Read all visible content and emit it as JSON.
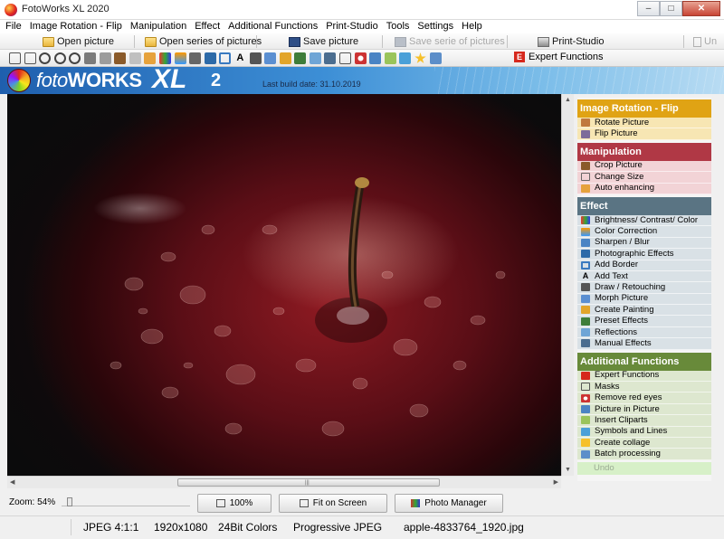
{
  "window": {
    "title": "FotoWorks XL 2020",
    "controls": [
      "–",
      "□",
      "✕"
    ]
  },
  "menu": [
    "File",
    "Image Rotation - Flip",
    "Manipulation",
    "Effect",
    "Additional Functions",
    "Print-Studio",
    "Tools",
    "Settings",
    "Help"
  ],
  "toolbar": {
    "open_picture": "Open picture",
    "open_series": "Open series of pictures",
    "save_picture": "Save picture",
    "save_series": "Save serie of pictures",
    "print_studio": "Print-Studio",
    "undo_truncated": "Un",
    "expert_functions": "Expert Functions",
    "expert_badge": "E"
  },
  "banner": {
    "logo_foto": "foto",
    "logo_works": "WORKS",
    "logo_xl": "XL",
    "logo_version": "2",
    "build_date": "Last build date: 31.10.2019"
  },
  "panel": {
    "rotation": {
      "title": "Image Rotation - Flip",
      "color": "#e0a314",
      "bg": "#f7e6b3",
      "items": [
        "Rotate Picture",
        "Flip Picture"
      ]
    },
    "manipulation": {
      "title": "Manipulation",
      "color": "#b03845",
      "bg": "#f2d3d6",
      "items": [
        "Crop Picture",
        "Change Size",
        "Auto enhancing"
      ]
    },
    "effect": {
      "title": "Effect",
      "color": "#5a7483",
      "bg": "#d9e1e6",
      "items": [
        "Brightness/ Contrast/ Color",
        "Color Correction",
        "Sharpen / Blur",
        "Photographic Effects",
        "Add Border",
        "Add Text",
        "Draw / Retouching",
        "Morph Picture",
        "Create Painting",
        "Preset Effects",
        "Reflections",
        "Manual Effects"
      ]
    },
    "additional": {
      "title": "Additional Functions",
      "color": "#688a3a",
      "bg": "#dde7cf",
      "items": [
        "Expert Functions",
        "Masks",
        "Remove red eyes",
        "Picture in Picture",
        "Insert Cliparts",
        "Symbols and Lines",
        "Create collage",
        "Batch processing"
      ]
    },
    "undo": "Undo"
  },
  "bottom": {
    "zoom_label": "Zoom: 54%",
    "zoom_value": 0.54,
    "btn_100": "100%",
    "btn_fit": "Fit on Screen",
    "btn_manager": "Photo Manager"
  },
  "status": {
    "format": "JPEG  4:1:1",
    "dimensions": "1920x1080",
    "colors": "24Bit Colors",
    "type": "Progressive JPEG",
    "filename": "apple-4833764_1920.jpg"
  },
  "colors": {
    "accent": "#1f5fae",
    "image_subject": "#8e1a22"
  }
}
